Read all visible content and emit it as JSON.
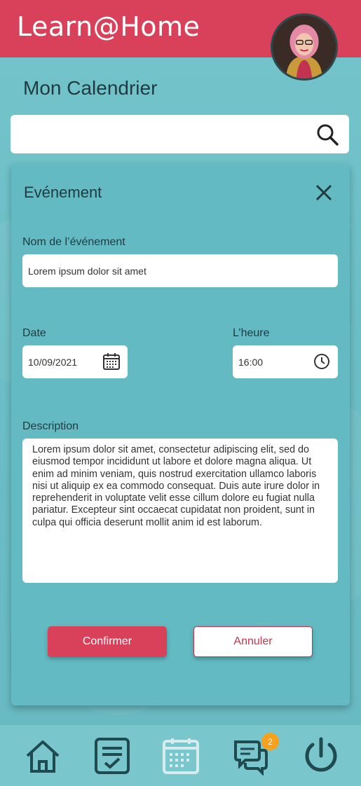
{
  "app": {
    "title": "Learn@Home"
  },
  "page": {
    "title": "Mon Calendrier"
  },
  "search": {
    "placeholder": ""
  },
  "event_panel": {
    "title": "Evénement",
    "name_label": "Nom de l’événement",
    "name_value": "Lorem ipsum dolor sit amet",
    "date_label": "Date",
    "date_value": "10/09/2021",
    "time_label": "L’heure",
    "time_value": "16:00",
    "description_label": "Description",
    "description_value": "Lorem ipsum dolor sit amet, consectetur adipiscing elit, sed do eiusmod tempor incididunt ut labore et dolore magna aliqua. Ut enim ad minim veniam, quis nostrud exercitation ullamco laboris nisi ut aliquip ex ea commodo consequat. Duis aute irure dolor in reprehenderit in voluptate velit esse cillum dolore eu fugiat nulla pariatur. Excepteur sint occaecat cupidatat non proident, sunt in culpa qui officia deserunt mollit anim id est laborum.",
    "confirm_label": "Confirmer",
    "cancel_label": "Annuler"
  },
  "bottom_nav": {
    "items": [
      {
        "icon": "home-icon"
      },
      {
        "icon": "tasks-icon"
      },
      {
        "icon": "calendar-icon",
        "active": true
      },
      {
        "icon": "chat-icon"
      },
      {
        "icon": "power-icon"
      }
    ],
    "chat_badge": "2"
  },
  "colors": {
    "brand": "#d9415a",
    "background": "#6fc0c8",
    "text_dark": "#1f3b40",
    "badge": "#f6a21e"
  }
}
